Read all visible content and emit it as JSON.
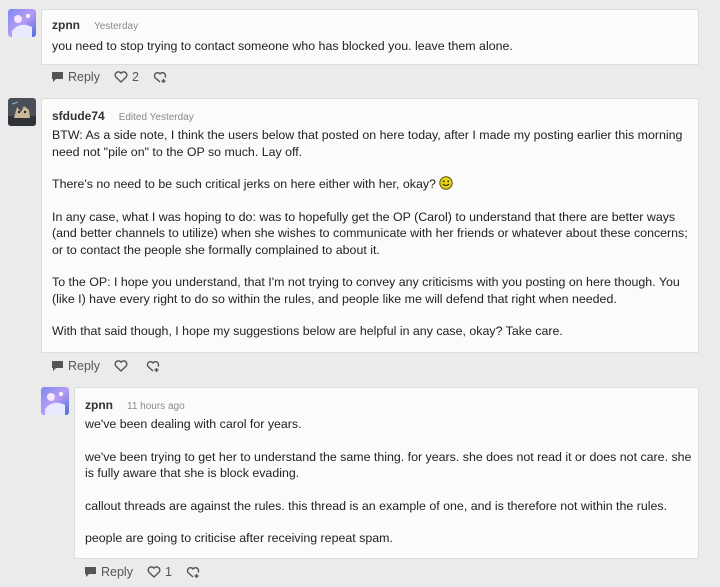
{
  "comments": [
    {
      "author": "zpnn",
      "time": "Yesterday",
      "paragraphs": [
        "you need to stop trying to contact someone who has blocked you. leave them alone."
      ],
      "reply_label": "Reply",
      "likes": "2"
    },
    {
      "author": "sfdude74",
      "time": "Edited Yesterday",
      "paragraphs": [
        "BTW: As a side note, I think the users below that posted on here today, after I made my posting earlier this morning need not \"pile on\" to the OP so much. Lay off.",
        "There's no need to be such critical jerks on here either with her, okay?",
        "In any case, what I was hoping to do: was to hopefully get the OP (Carol) to understand that there are better ways (and better channels to utilize) when she wishes to communicate with her friends or whatever about these concerns; or to contact the people she formally complained to about it.",
        "To the OP: I hope you understand, that I'm not trying to convey any criticisms with you posting on here though. You (like I) have every right to do so within the rules, and people like me will defend that right when needed.",
        "With that said though, I hope my suggestions below are helpful in any case, okay? Take care."
      ],
      "reply_label": "Reply",
      "likes": ""
    },
    {
      "author": "zpnn",
      "time": "11 hours ago",
      "paragraphs": [
        "we've been dealing with carol for years.",
        "we've been trying to get her to understand the same thing. for years. she does not read it or does not care. she is fully aware that she is block evading.",
        "callout threads are against the rules. this thread is an example of one, and is therefore not within the rules.",
        "people are going to criticise after receiving repeat spam."
      ],
      "reply_label": "Reply",
      "likes": "1"
    }
  ],
  "icons": {
    "reply": "speech-bubble-icon",
    "like": "heart-icon",
    "kudo": "gift-heart-icon",
    "smiley": "smiley-emoji-icon"
  }
}
